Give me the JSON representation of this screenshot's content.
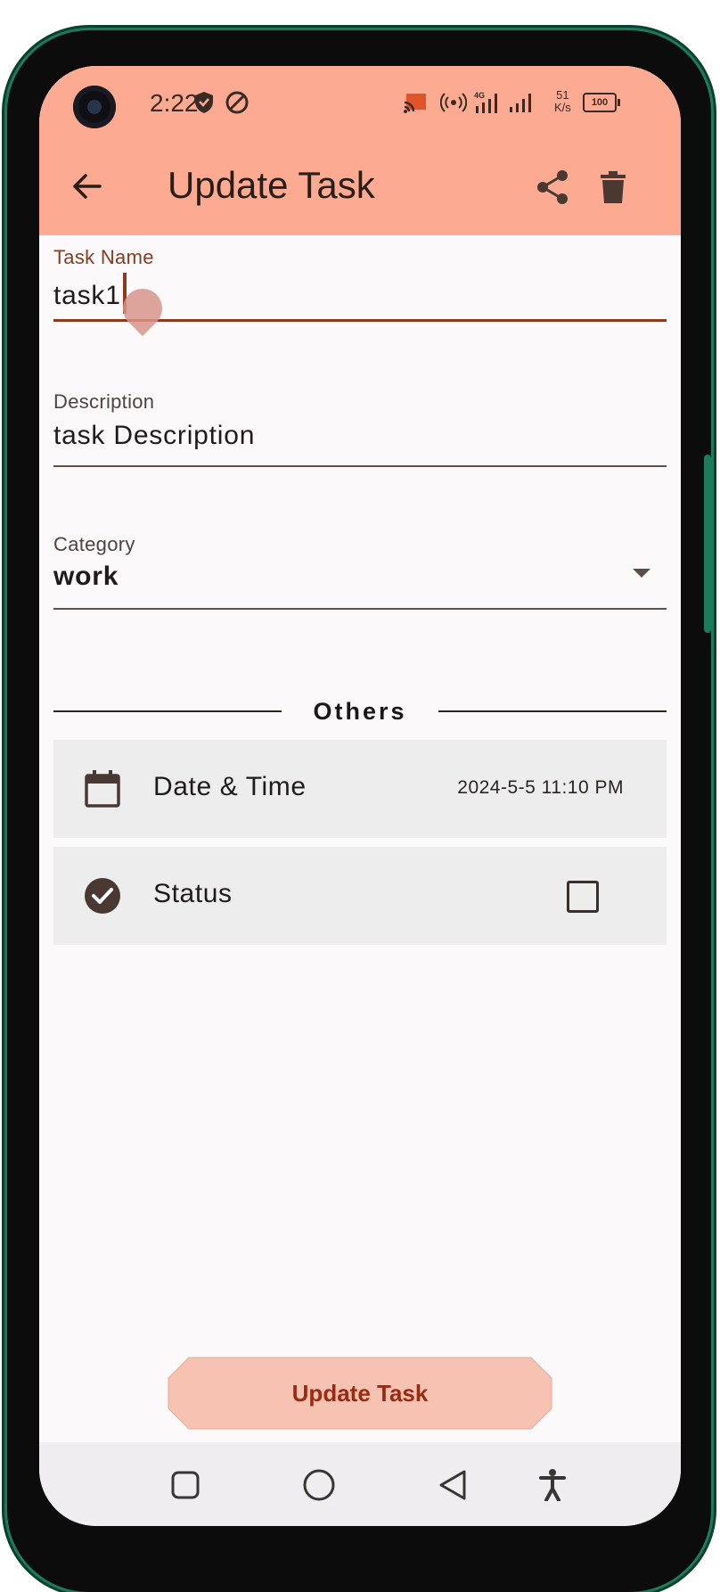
{
  "status_bar": {
    "time": "2:22",
    "network_speed_value": "51",
    "network_speed_unit": "K/s",
    "network_type": "4G",
    "battery": "100"
  },
  "app_bar": {
    "title": "Update Task",
    "color": "#fcab92"
  },
  "form": {
    "task_name": {
      "label": "Task Name",
      "value": "task1"
    },
    "description": {
      "label": "Description",
      "value": "task Description"
    },
    "category": {
      "label": "Category",
      "value": "work"
    }
  },
  "others": {
    "heading": "Others",
    "date_time": {
      "label": "Date & Time",
      "value": "2024-5-5 11:10 PM"
    },
    "status": {
      "label": "Status",
      "checked": false
    }
  },
  "update_button": {
    "label": "Update Task",
    "color": "#f6c2b2"
  },
  "icons": [
    "back-arrow-icon",
    "share-icon",
    "trash-icon",
    "calendar-icon",
    "check-circle-icon",
    "dropdown-arrow-icon"
  ]
}
